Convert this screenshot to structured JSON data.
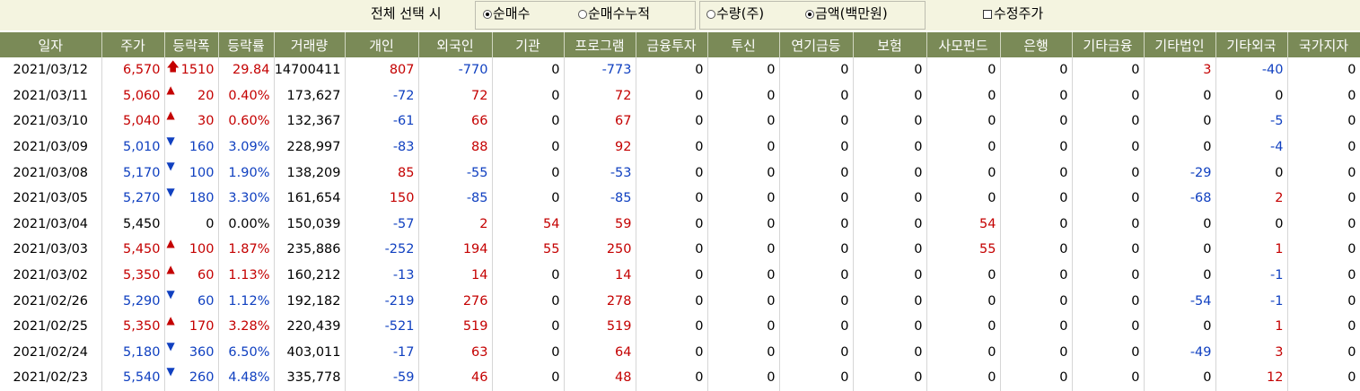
{
  "toolbar": {
    "select_all": "전체 선택 시",
    "radio1": {
      "label": "순매수",
      "checked": true
    },
    "radio2": {
      "label": "순매수누적",
      "checked": false
    },
    "radio3": {
      "label": "수량(주)",
      "checked": false
    },
    "radio4": {
      "label": "금액(백만원)",
      "checked": true
    },
    "adjusted": {
      "label": "수정주가",
      "checked": false
    }
  },
  "headers": [
    "일자",
    "주가",
    "등락폭",
    "등락률",
    "거래량",
    "개인",
    "외국인",
    "기관",
    "프로그램",
    "금융투자",
    "투신",
    "연기금등",
    "보험",
    "사모펀드",
    "은행",
    "기타금융",
    "기타법인",
    "기타외국",
    "국가지자"
  ],
  "colors": {
    "up": "#c40000",
    "down": "#1040c0",
    "header_bg": "#7a8a57",
    "toolbar_bg": "#f4f4e0"
  },
  "rows": [
    {
      "date": "2021/03/12",
      "price": "6,570",
      "dir": "upper",
      "change": "1510",
      "rate": "29.84",
      "volume": "14700411",
      "vals": [
        "807",
        "-770",
        "0",
        "-773",
        "0",
        "0",
        "0",
        "0",
        "0",
        "0",
        "0",
        "3",
        "-40",
        "0"
      ]
    },
    {
      "date": "2021/03/11",
      "price": "5,060",
      "dir": "up",
      "change": "20",
      "rate": "0.40%",
      "volume": "173,627",
      "vals": [
        "-72",
        "72",
        "0",
        "72",
        "0",
        "0",
        "0",
        "0",
        "0",
        "0",
        "0",
        "0",
        "0",
        "0"
      ]
    },
    {
      "date": "2021/03/10",
      "price": "5,040",
      "dir": "up",
      "change": "30",
      "rate": "0.60%",
      "volume": "132,367",
      "vals": [
        "-61",
        "66",
        "0",
        "67",
        "0",
        "0",
        "0",
        "0",
        "0",
        "0",
        "0",
        "0",
        "-5",
        "0"
      ]
    },
    {
      "date": "2021/03/09",
      "price": "5,010",
      "dir": "down",
      "change": "160",
      "rate": "3.09%",
      "volume": "228,997",
      "vals": [
        "-83",
        "88",
        "0",
        "92",
        "0",
        "0",
        "0",
        "0",
        "0",
        "0",
        "0",
        "0",
        "-4",
        "0"
      ]
    },
    {
      "date": "2021/03/08",
      "price": "5,170",
      "dir": "down",
      "change": "100",
      "rate": "1.90%",
      "volume": "138,209",
      "vals": [
        "85",
        "-55",
        "0",
        "-53",
        "0",
        "0",
        "0",
        "0",
        "0",
        "0",
        "0",
        "-29",
        "0",
        "0"
      ]
    },
    {
      "date": "2021/03/05",
      "price": "5,270",
      "dir": "down",
      "change": "180",
      "rate": "3.30%",
      "volume": "161,654",
      "vals": [
        "150",
        "-85",
        "0",
        "-85",
        "0",
        "0",
        "0",
        "0",
        "0",
        "0",
        "0",
        "-68",
        "2",
        "0"
      ]
    },
    {
      "date": "2021/03/04",
      "price": "5,450",
      "dir": "flat",
      "change": "0",
      "rate": "0.00%",
      "volume": "150,039",
      "vals": [
        "-57",
        "2",
        "54",
        "59",
        "0",
        "0",
        "0",
        "0",
        "54",
        "0",
        "0",
        "0",
        "0",
        "0"
      ]
    },
    {
      "date": "2021/03/03",
      "price": "5,450",
      "dir": "up",
      "change": "100",
      "rate": "1.87%",
      "volume": "235,886",
      "vals": [
        "-252",
        "194",
        "55",
        "250",
        "0",
        "0",
        "0",
        "0",
        "55",
        "0",
        "0",
        "0",
        "1",
        "0"
      ]
    },
    {
      "date": "2021/03/02",
      "price": "5,350",
      "dir": "up",
      "change": "60",
      "rate": "1.13%",
      "volume": "160,212",
      "vals": [
        "-13",
        "14",
        "0",
        "14",
        "0",
        "0",
        "0",
        "0",
        "0",
        "0",
        "0",
        "0",
        "-1",
        "0"
      ]
    },
    {
      "date": "2021/02/26",
      "price": "5,290",
      "dir": "down",
      "change": "60",
      "rate": "1.12%",
      "volume": "192,182",
      "vals": [
        "-219",
        "276",
        "0",
        "278",
        "0",
        "0",
        "0",
        "0",
        "0",
        "0",
        "0",
        "-54",
        "-1",
        "0"
      ]
    },
    {
      "date": "2021/02/25",
      "price": "5,350",
      "dir": "up",
      "change": "170",
      "rate": "3.28%",
      "volume": "220,439",
      "vals": [
        "-521",
        "519",
        "0",
        "519",
        "0",
        "0",
        "0",
        "0",
        "0",
        "0",
        "0",
        "0",
        "1",
        "0"
      ]
    },
    {
      "date": "2021/02/24",
      "price": "5,180",
      "dir": "down",
      "change": "360",
      "rate": "6.50%",
      "volume": "403,011",
      "vals": [
        "-17",
        "63",
        "0",
        "64",
        "0",
        "0",
        "0",
        "0",
        "0",
        "0",
        "0",
        "-49",
        "3",
        "0"
      ]
    },
    {
      "date": "2021/02/23",
      "price": "5,540",
      "dir": "down",
      "change": "260",
      "rate": "4.48%",
      "volume": "335,778",
      "vals": [
        "-59",
        "46",
        "0",
        "48",
        "0",
        "0",
        "0",
        "0",
        "0",
        "0",
        "0",
        "0",
        "12",
        "0"
      ]
    }
  ]
}
